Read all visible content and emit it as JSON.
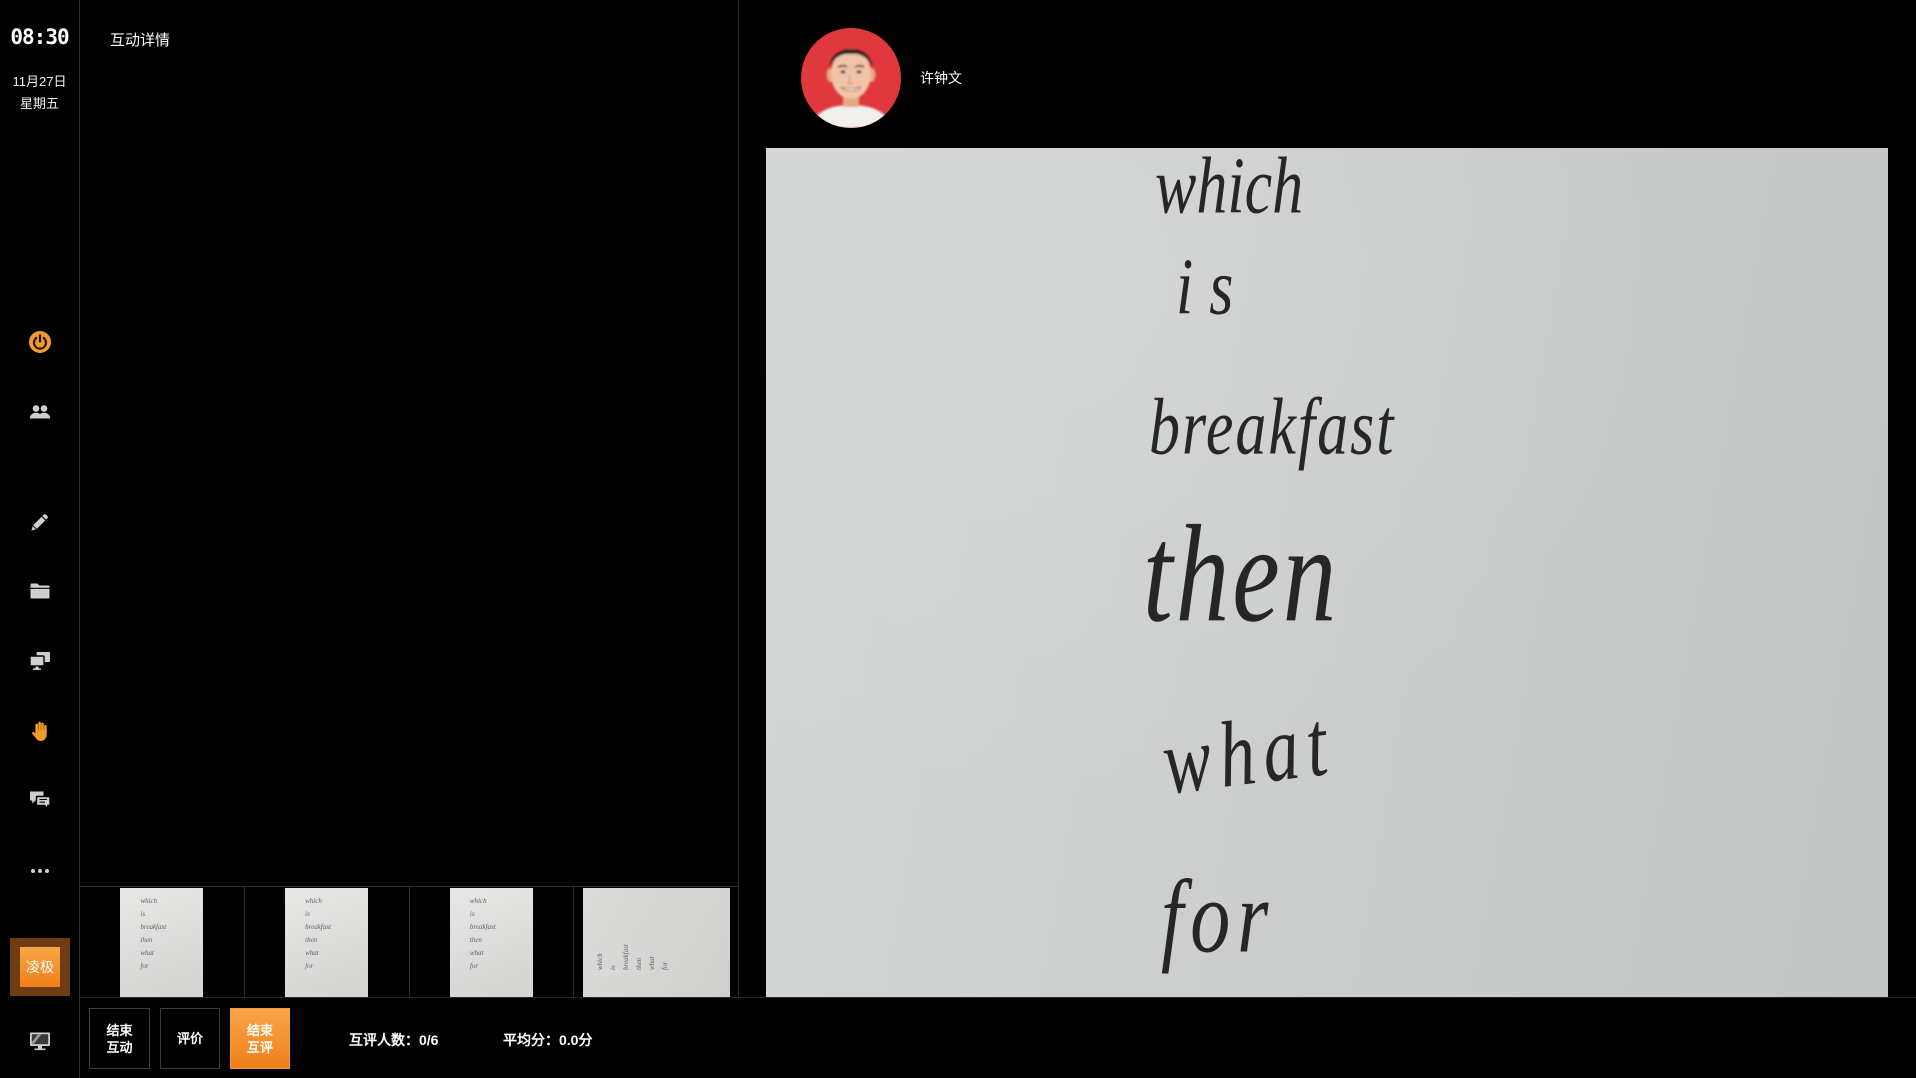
{
  "sidebar": {
    "clock": "08:30",
    "date": "11月27日",
    "weekday": "星期五",
    "brand_label": "凌极",
    "icons": [
      "power-icon",
      "people-icon",
      "pencil-icon",
      "folder-icon",
      "screens-icon",
      "raise-hand-icon",
      "chat-icon",
      "more-icon",
      "monitor-icon"
    ]
  },
  "detail_panel": {
    "title": "互动详情"
  },
  "student": {
    "name": "许钟文"
  },
  "submission": {
    "handwritten_words": [
      "which",
      "is",
      "breakfast",
      "then",
      "what",
      "for"
    ]
  },
  "bottom_bar": {
    "end_interaction": [
      "结束",
      "互动"
    ],
    "evaluate": "评价",
    "end_peer_review": [
      "结束",
      "互评"
    ],
    "peer_review_count_label": "互评人数：",
    "peer_review_count": "0/6",
    "average_score_label": "平均分：",
    "average_score": "0.0分"
  },
  "colors": {
    "background": "#000000",
    "accent": "#f28c28",
    "avatar_background": "#e0383d",
    "text": "#ffffff"
  }
}
